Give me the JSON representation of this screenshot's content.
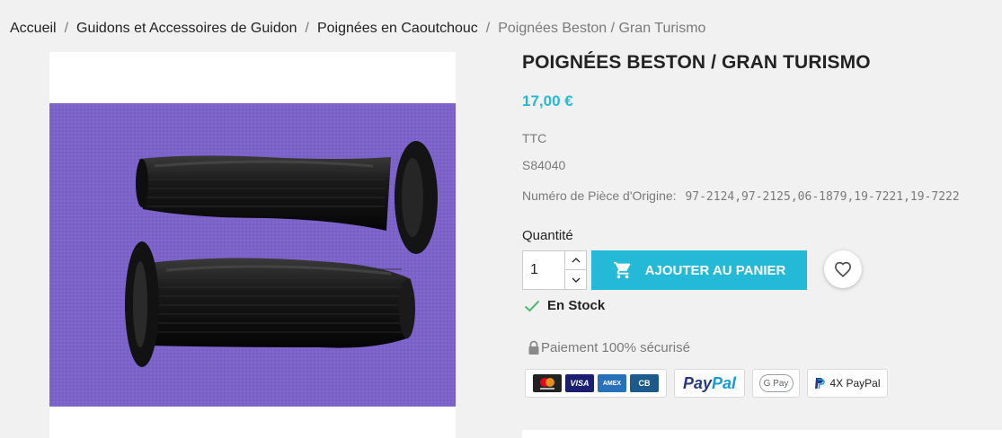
{
  "breadcrumb": {
    "items": [
      "Accueil",
      "Guidons et Accessoires de Guidon",
      "Poignées en Caoutchouc"
    ],
    "separator": "/",
    "current": "Poignées Beston / Gran Turismo"
  },
  "product": {
    "title": "POIGNÉES BESTON / GRAN TURISMO",
    "price": "17,00 €",
    "tax_label": "TTC",
    "reference": "S84040",
    "oem_label": "Numéro de Pièce d'Origine:",
    "oem_value": "97-2124,97-2125,06-1879,19-7221,19-7222",
    "image_icon": "product-photo-handlebar-grips"
  },
  "purchase": {
    "quantity_label": "Quantité",
    "quantity_value": "1",
    "add_to_cart_label": "AJOUTER AU PANIER",
    "stock_label": "En Stock"
  },
  "payment": {
    "secure_label": "Paiement 100% sécurisé",
    "cards": [
      "mastercard",
      "VISA",
      "AMEX",
      "CB"
    ],
    "paypal_a": "Pay",
    "paypal_b": "Pal",
    "gpay_label": "G Pay",
    "paypal_4x_label": "4X PayPal"
  },
  "colors": {
    "accent": "#24b9d7",
    "photo_background": "#7c63c9",
    "stock_check": "#4cbb6c"
  }
}
